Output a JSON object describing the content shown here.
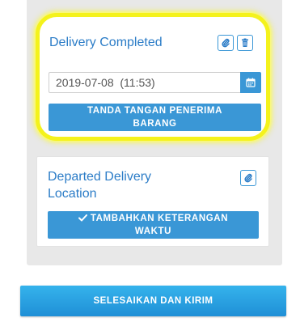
{
  "cards": [
    {
      "title": "Delivery Completed",
      "date_value": "2019-07-08  (11:53)",
      "button_label": "TANDA TANGAN PENERIMA BARANG",
      "icons": [
        "paperclip-icon",
        "trash-icon",
        "calendar-icon"
      ]
    },
    {
      "title": "Departed Delivery Location",
      "button_label": "TAMBAHKAN KETERANGAN WAKTU",
      "button_icon": "check-icon",
      "icons": [
        "paperclip-icon"
      ]
    }
  ],
  "submit_label": "SELESAIKAN DAN KIRIM",
  "colors": {
    "accent": "#3a97d6",
    "title_text": "#2b7cc7",
    "highlight": "#f4f21c",
    "panel_bg": "#e8e8e8"
  }
}
